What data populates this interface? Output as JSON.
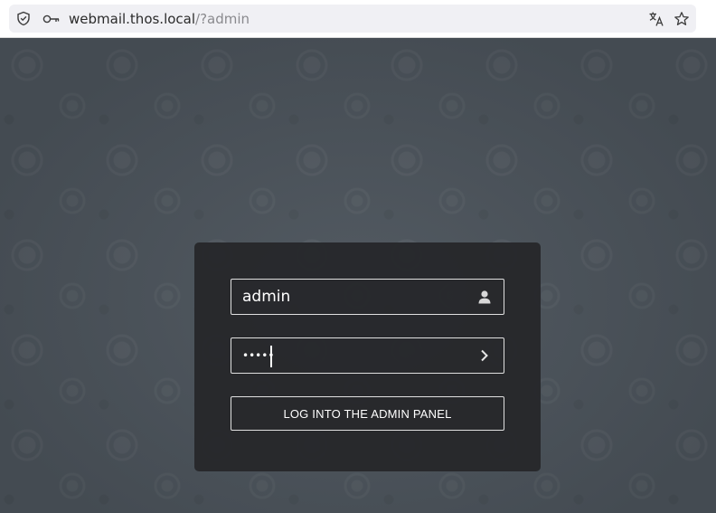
{
  "browser": {
    "url_host": "webmail.thos.local",
    "url_path": "/?admin"
  },
  "login": {
    "username_value": "admin",
    "password_masked": "•••••",
    "submit_label": "LOG INTO THE ADMIN PANEL"
  },
  "icons": {
    "shield": "shield-icon",
    "key": "key-icon",
    "translate": "translate-icon",
    "bookmark": "star-icon",
    "user": "user-icon",
    "submit_arrow": "chevron-right-icon"
  }
}
